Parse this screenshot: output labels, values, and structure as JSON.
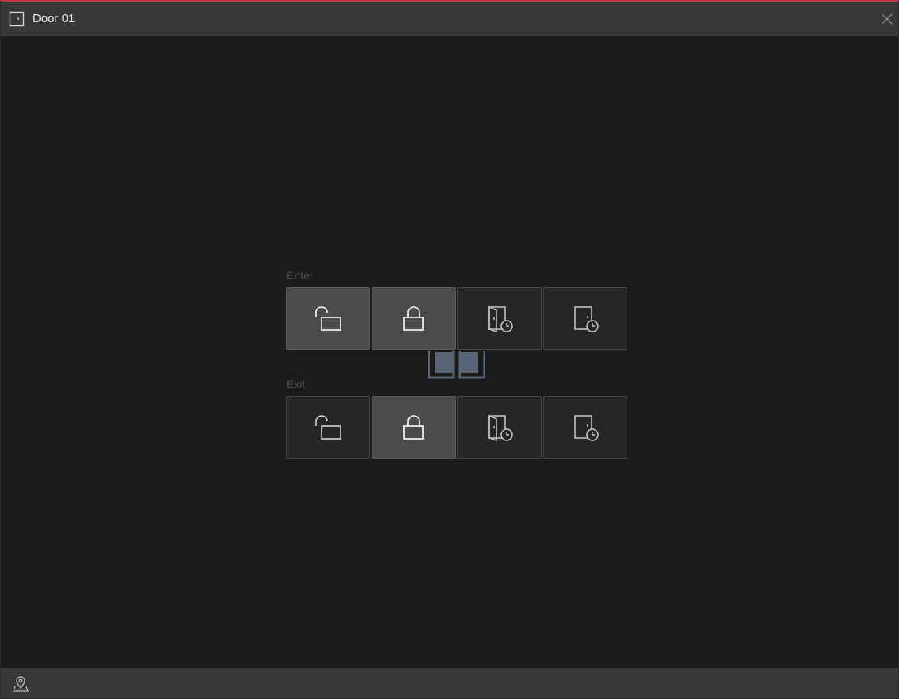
{
  "window": {
    "title": "Door 01",
    "accent_color": "#c4383c"
  },
  "icons": {
    "title": "door-icon",
    "close": "close-icon",
    "location": "location-pin-icon"
  },
  "enter": {
    "label": "Enter",
    "buttons": [
      {
        "icon": "unlock-icon",
        "active": true
      },
      {
        "icon": "lock-icon",
        "active": true
      },
      {
        "icon": "door-open-timer-icon",
        "active": false
      },
      {
        "icon": "door-closed-timer-icon",
        "active": false
      }
    ]
  },
  "exit": {
    "label": "Exit",
    "buttons": [
      {
        "icon": "unlock-icon",
        "active": false
      },
      {
        "icon": "lock-icon",
        "active": true
      },
      {
        "icon": "door-open-timer-icon",
        "active": false
      },
      {
        "icon": "door-closed-timer-icon",
        "active": false
      }
    ]
  }
}
